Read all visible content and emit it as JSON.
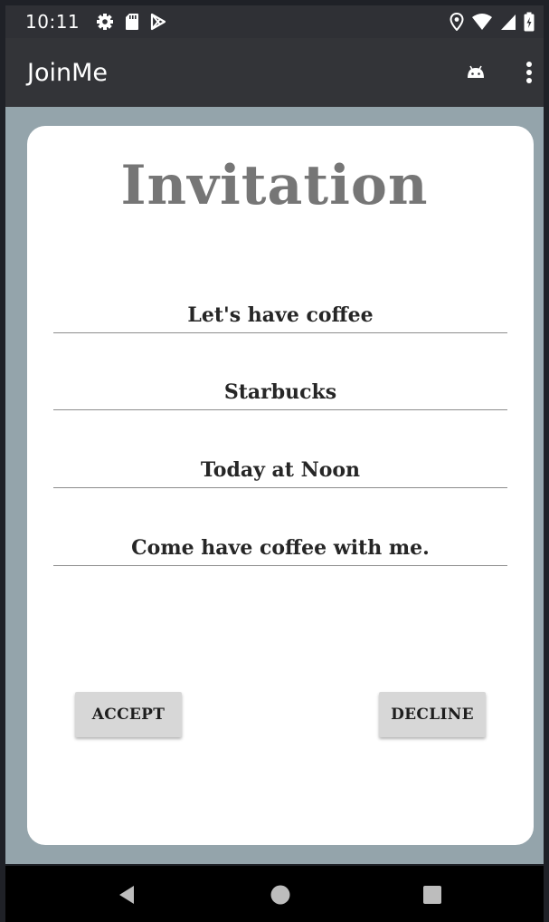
{
  "status_bar": {
    "time": "10:11",
    "left_icons": [
      "gear-icon",
      "sd-card-icon",
      "play-store-icon"
    ],
    "right_icons": [
      "location-icon",
      "wifi-icon",
      "signal-icon",
      "battery-icon"
    ]
  },
  "app_bar": {
    "title": "JoinMe",
    "actions": [
      "android-icon",
      "overflow-menu-icon"
    ]
  },
  "invitation": {
    "title": "Invitation",
    "fields": {
      "event": "Let's have coffee",
      "location": "Starbucks",
      "time": "Today at Noon",
      "message": "Come have coffee with me."
    },
    "buttons": {
      "accept": "ACCEPT",
      "decline": "DECLINE"
    }
  },
  "nav_bar": {
    "buttons": [
      "back-icon",
      "home-icon",
      "recents-icon"
    ]
  },
  "colors": {
    "status_bar": "#2f3035",
    "app_bar": "#333438",
    "content_background": "#94a4ab",
    "card": "#ffffff",
    "title_text": "#767676",
    "button": "#d7d7d7"
  }
}
